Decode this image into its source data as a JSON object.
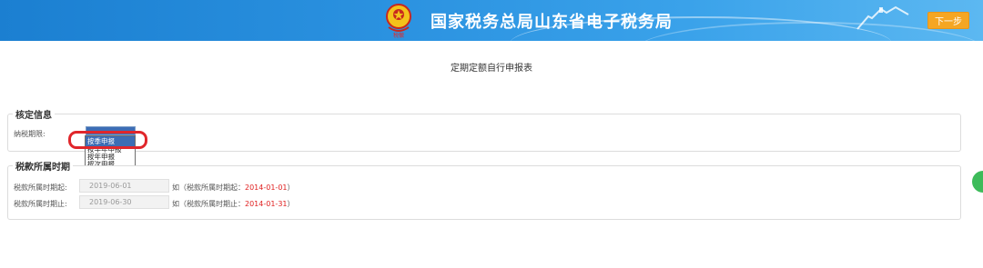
{
  "header": {
    "emblem_text": "税徽",
    "title": "国家税务总局山东省电子税务局",
    "next_label": "下一步"
  },
  "page_title": "定期定额自行申报表",
  "section_assessment": {
    "legend": "核定信息",
    "period_label": "纳税期限:",
    "period_options": [
      "按季申报",
      "按半年申报",
      "按年申报",
      "按次申报"
    ],
    "selected_index": 0
  },
  "section_tax_period": {
    "legend": "税款所属时期",
    "start_label": "税款所属时期起:",
    "start_value": "2019-06-01",
    "start_hint_prefix": "如（税款所属时期起：",
    "start_hint_value": "2014-01-01",
    "start_hint_suffix": "）",
    "end_label": "税款所属时期止:",
    "end_value": "2019-06-30",
    "end_hint_prefix": "如（税款所属时期止：",
    "end_hint_value": "2014-01-31",
    "end_hint_suffix": "）"
  },
  "colors": {
    "banner": "#2b92e0",
    "next_button": "#f5a623",
    "highlight": "#e0262b",
    "hint_red": "#e02020"
  }
}
